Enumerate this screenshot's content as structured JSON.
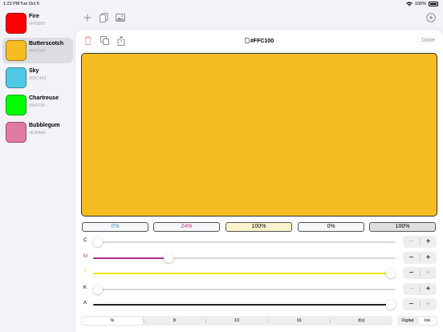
{
  "status": {
    "time": "1:23 PM",
    "date": "Tue Oct 6",
    "battery": "100%"
  },
  "sidebar": {
    "items": [
      {
        "name": "Fire",
        "hex": "#FF0000",
        "color": "#ff0000",
        "selected": false
      },
      {
        "name": "Butterscotch",
        "hex": "#FFC100",
        "color": "#f5bd22",
        "selected": true
      },
      {
        "name": "Sky",
        "hex": "#6DC4E2",
        "color": "#4fc9e6",
        "selected": false
      },
      {
        "name": "Chartreuse",
        "hex": "#00FF00",
        "color": "#00ff00",
        "selected": false
      },
      {
        "name": "Bubblegum",
        "hex": "#E384A6",
        "color": "#e07aa3",
        "selected": false
      }
    ]
  },
  "toolbar": {
    "icons": [
      "plus-icon",
      "copy-icon",
      "image-icon",
      "play-circle-icon"
    ]
  },
  "card": {
    "title": "#FFC100",
    "done_label": "Done",
    "preview_color": "#f5bd22",
    "icons": [
      "trash-icon",
      "duplicate-icon",
      "share-icon",
      "document-icon"
    ]
  },
  "values": [
    {
      "label": "0%",
      "text_color": "#2a9fd6",
      "bg": "#f6f6f8"
    },
    {
      "label": "24%",
      "text_color": "#c42a87",
      "bg": "#f6f6f8"
    },
    {
      "label": "100%",
      "text_color": "#000000",
      "bg": "#faf3cc"
    },
    {
      "label": "0%",
      "text_color": "#000000",
      "bg": "#f6f6f8"
    },
    {
      "label": "100%",
      "text_color": "#000000",
      "bg": "#dedee0"
    }
  ],
  "sliders": [
    {
      "label": "C",
      "level": 0,
      "fill_color": "#000000",
      "label_color": "#000000",
      "minus_enabled": false,
      "plus_enabled": true
    },
    {
      "label": "M",
      "level": 0.24,
      "fill_color": "#b3308c",
      "label_color": "#b3308c",
      "minus_enabled": true,
      "plus_enabled": true
    },
    {
      "label": "Y",
      "level": 1,
      "fill_color": "#f2e600",
      "label_color": "#e8d800",
      "minus_enabled": true,
      "plus_enabled": false
    },
    {
      "label": "K",
      "level": 0,
      "fill_color": "#000000",
      "label_color": "#000000",
      "minus_enabled": false,
      "plus_enabled": true
    },
    {
      "label": "A",
      "level": 1,
      "fill_color": "#222222",
      "label_color": "#000000",
      "minus_enabled": true,
      "plus_enabled": false
    }
  ],
  "format_segments": [
    {
      "label": "%",
      "selected": true
    },
    {
      "label": "8",
      "selected": false
    },
    {
      "label": "10",
      "selected": false
    },
    {
      "label": "16",
      "selected": false
    },
    {
      "label": "f(x)",
      "selected": false
    }
  ],
  "mode_segments": [
    {
      "label": "Digital",
      "selected": false
    },
    {
      "label": "Ink",
      "selected": true
    }
  ]
}
